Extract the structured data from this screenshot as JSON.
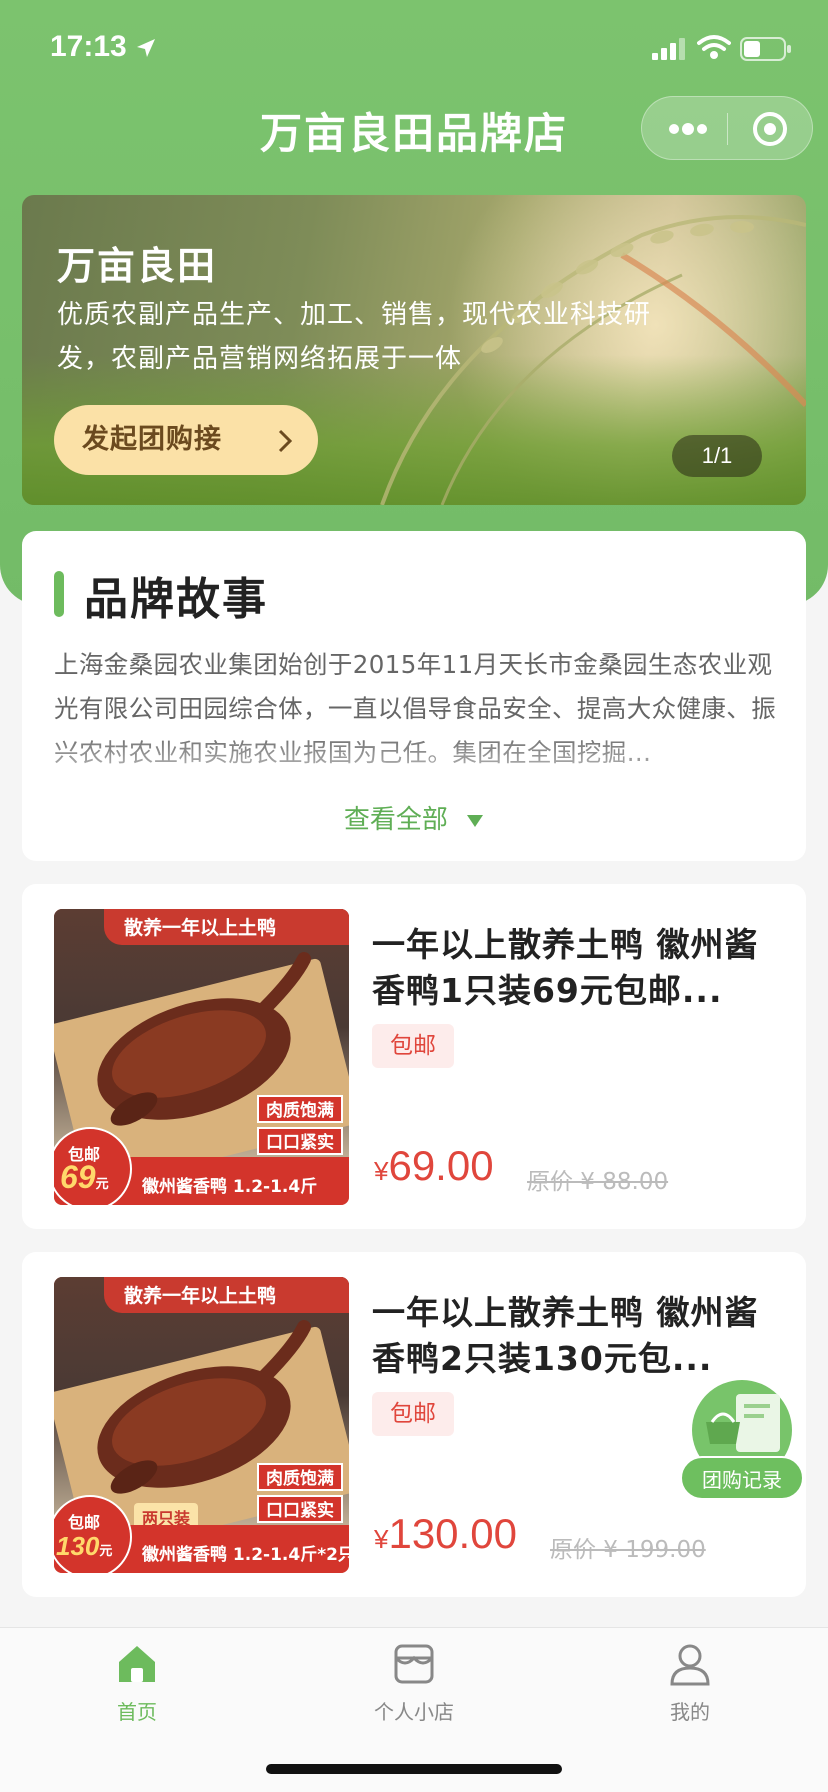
{
  "status": {
    "time": "17:13"
  },
  "nav": {
    "title": "万亩良田品牌店"
  },
  "banner": {
    "title": "万亩良田",
    "description": "优质农副产品生产、加工、销售，现代农业科技研发，农副产品营销网络拓展于一体",
    "button_label": "发起团购接",
    "indicator": "1/1"
  },
  "story": {
    "title": "品牌故事",
    "text": "上海金桑园农业集团始创于2015年11月天长市金桑园生态农业观光有限公司田园综合体，一直以倡导食品安全、提高大众健康、振兴农村农业和实施农业报国为己任。集团在全国挖掘...",
    "more_label": "查看全部"
  },
  "products": [
    {
      "title": "一年以上散养土鸭 徽州酱香鸭1只装69元包邮...",
      "badge": "包邮",
      "price_symbol": "¥",
      "price": "69.00",
      "original_price": "原价 ¥ 88.00",
      "image": {
        "top_text": "散养一年以上土鸭",
        "tag1": "肉质饱满",
        "tag2": "口口紧实",
        "circle_label": "包邮",
        "circle_value": "69",
        "circle_unit": "元",
        "bottom_text": "徽州酱香鸭 1.2-1.4斤"
      }
    },
    {
      "title": "一年以上散养土鸭 徽州酱香鸭2只装130元包...",
      "badge": "包邮",
      "price_symbol": "¥",
      "price": "130.00",
      "original_price": "原价 ¥ 199.00",
      "image": {
        "top_text": "散养一年以上土鸭",
        "tag1": "肉质饱满",
        "tag2": "口口紧实",
        "circle_label": "包邮",
        "circle_value": "130",
        "circle_unit": "元",
        "two_tag": "两只装",
        "bottom_text": "徽州酱香鸭 1.2-1.4斤*2只"
      }
    }
  ],
  "fab": {
    "label": "团购记录"
  },
  "tabbar": {
    "items": [
      {
        "label": "首页",
        "icon": "home-icon",
        "active": true
      },
      {
        "label": "个人小店",
        "icon": "shop-icon",
        "active": false
      },
      {
        "label": "我的",
        "icon": "user-icon",
        "active": false
      }
    ]
  },
  "colors": {
    "brand_green": "#78c46a",
    "price_red": "#e0463c",
    "banner_button": "#fbe1a7"
  }
}
